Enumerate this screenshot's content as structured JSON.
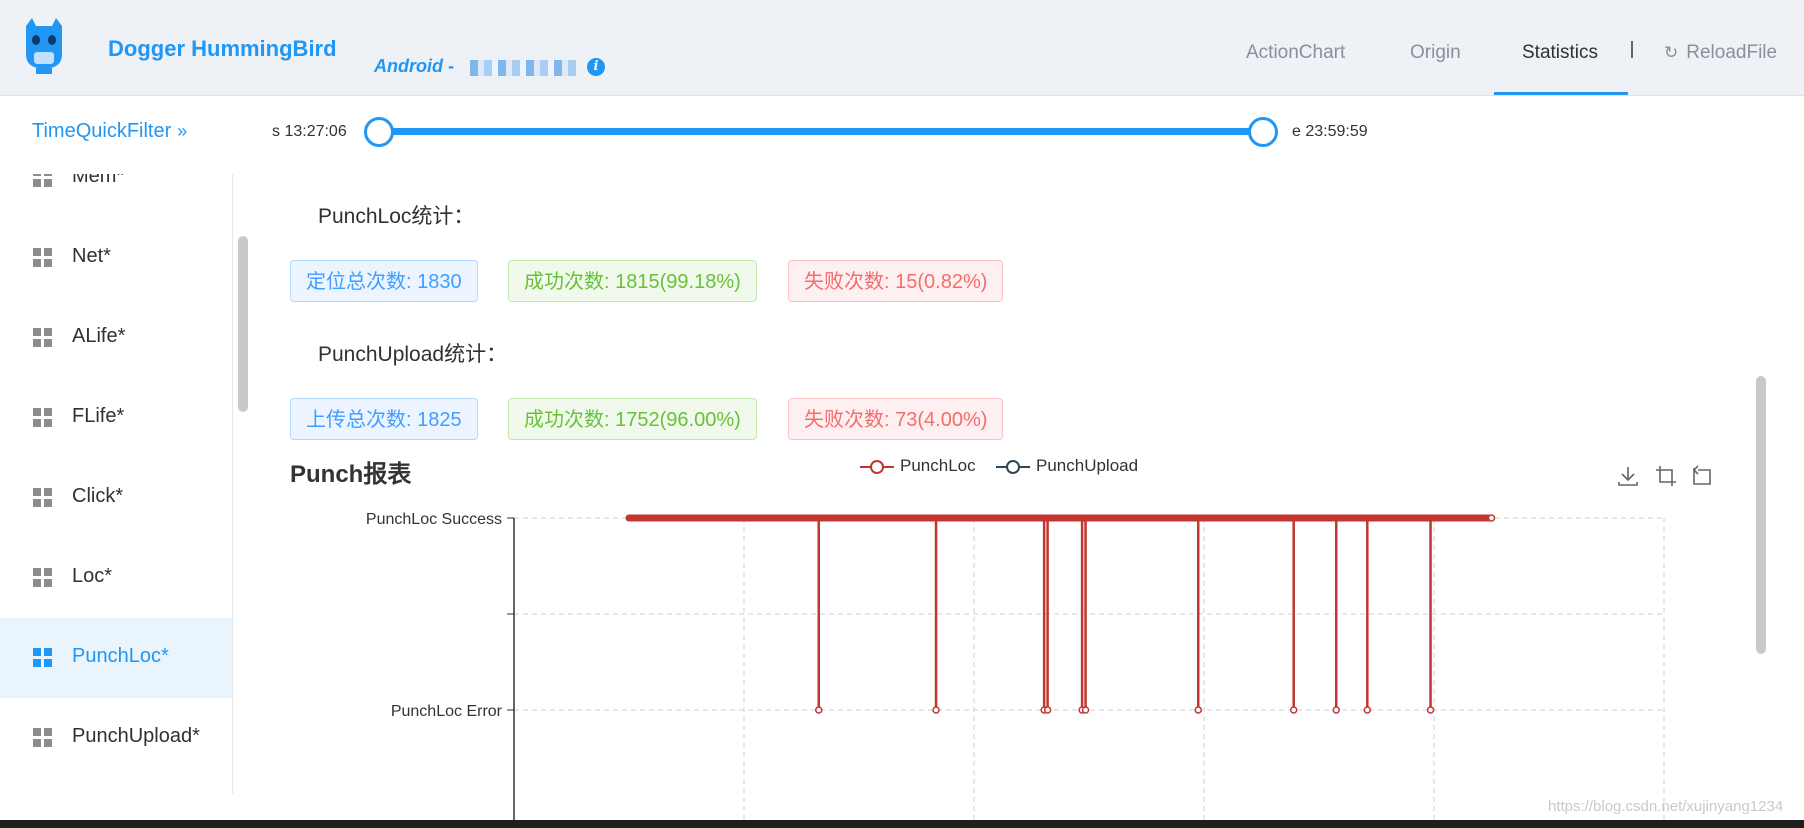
{
  "header": {
    "app_title": "Dogger HummingBird",
    "platform_label": "Android -",
    "info_icon": "i",
    "nav": [
      {
        "label": "ActionChart"
      },
      {
        "label": "Origin"
      },
      {
        "label": "Statistics",
        "active": true
      }
    ],
    "reload_label": "ReloadFile",
    "accent_color": "#2196f3"
  },
  "filter": {
    "title": "TimeQuickFilter",
    "arrow": "»",
    "start_label": "s 13:27:06",
    "end_label": "e 23:59:59",
    "range_fraction": [
      0.0,
      1.0
    ]
  },
  "sidebar": {
    "items": [
      {
        "label": "Mem*",
        "icon": "grid-icon"
      },
      {
        "label": "Net*",
        "icon": "grid-icon"
      },
      {
        "label": "ALife*",
        "icon": "grid-icon"
      },
      {
        "label": "FLife*",
        "icon": "grid-icon"
      },
      {
        "label": "Click*",
        "icon": "grid-icon"
      },
      {
        "label": "Loc*",
        "icon": "grid-icon"
      },
      {
        "label": "PunchLoc*",
        "icon": "grid-icon",
        "active": true
      },
      {
        "label": "PunchUpload*",
        "icon": "grid-icon"
      }
    ]
  },
  "stats": {
    "punchloc_title": "PunchLoc统计：",
    "punchloc_tags": [
      "定位总次数: 1830",
      "成功次数: 1815(99.18%)",
      "失败次数: 15(0.82%)"
    ],
    "punchupload_title": "PunchUpload统计：",
    "punchupload_tags": [
      "上传总次数: 1825",
      "成功次数: 1752(96.00%)",
      "失败次数: 73(4.00%)"
    ]
  },
  "chart_data": {
    "type": "line",
    "title": "Punch报表",
    "legend": [
      "PunchLoc",
      "PunchUpload"
    ],
    "legend_placement": "top-center",
    "y_categories": [
      "PunchLoc Error",
      "",
      "PunchLoc Success"
    ],
    "grid": true,
    "series": [
      {
        "name": "PunchLoc",
        "color": "#c23531",
        "success_span": [
          0.1,
          0.85
        ],
        "error_events": [
          0.265,
          0.367,
          0.461,
          0.464,
          0.494,
          0.497,
          0.595,
          0.678,
          0.715,
          0.742,
          0.797
        ]
      },
      {
        "name": "PunchUpload",
        "color": "#2f4554"
      }
    ]
  },
  "watermark": "https://blog.csdn.net/xujinyang1234"
}
